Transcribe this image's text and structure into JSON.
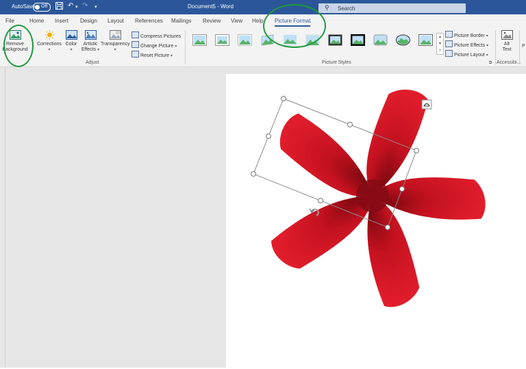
{
  "title_bar": {
    "autosave_label": "AutoSave",
    "autosave_state": "Off",
    "document_title": "Document5  -  Word",
    "search_placeholder": "Search"
  },
  "tabs": [
    {
      "label": "File"
    },
    {
      "label": "Home"
    },
    {
      "label": "Insert"
    },
    {
      "label": "Design"
    },
    {
      "label": "Layout"
    },
    {
      "label": "References"
    },
    {
      "label": "Mailings"
    },
    {
      "label": "Review"
    },
    {
      "label": "View"
    },
    {
      "label": "Help"
    },
    {
      "label": "Picture Format",
      "active": true
    }
  ],
  "ribbon": {
    "remove_background": {
      "line1": "Remove",
      "line2": "Background"
    },
    "corrections": "Corrections",
    "color": "Color",
    "artistic_effects": {
      "line1": "Artistic",
      "line2": "Effects"
    },
    "transparency": "Transparency",
    "compress_pictures": "Compress Pictures",
    "change_picture": "Change Picture",
    "reset_picture": "Reset Picture",
    "adjust_group_label": "Adjust",
    "picture_styles_group_label": "Picture Styles",
    "picture_border": "Picture Border",
    "picture_effects": "Picture Effects",
    "picture_layout": "Picture Layout",
    "alt_text": {
      "line1": "Alt",
      "line2": "Text"
    },
    "accessibility_group_label": "Accessibi..."
  },
  "colors": {
    "title_bar": "#2b579a",
    "annotation_green": "#1e9a3c",
    "flower_red": "#d8192a",
    "flower_dark": "#7a0810"
  }
}
